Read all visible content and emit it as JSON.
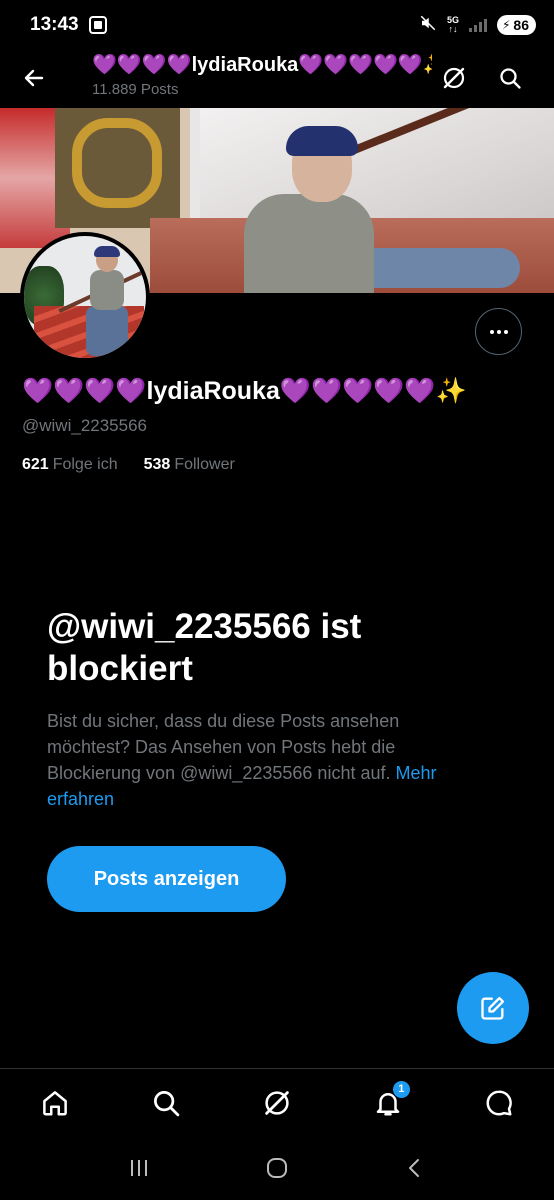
{
  "status_bar": {
    "time": "13:43",
    "network": "5G",
    "battery": "86"
  },
  "header": {
    "title": "💜💜💜💜lydiaRouka💜💜💜💜💜✨",
    "posts_count": "11.889 Posts"
  },
  "profile": {
    "display_name": "💜💜💜💜lydiaRouka💜💜💜💜💜✨",
    "handle": "@wiwi_2235566",
    "following_count": "621",
    "following_label": "Folge ich",
    "followers_count": "538",
    "followers_label": "Follower"
  },
  "blocked": {
    "title": "@wiwi_2235566 ist blockiert",
    "description": "Bist du sicher, dass du diese Posts ansehen möchtest? Das Ansehen von Posts hebt die Blockierung von @wiwi_2235566 nicht auf.",
    "link": "Mehr erfahren",
    "button_label": "Posts anzeigen"
  },
  "bottom_nav": {
    "notifications_badge": "1"
  },
  "colors": {
    "accent": "#1d9bf0",
    "background": "#000000",
    "secondary_text": "#71767b"
  },
  "icons": {
    "back": "arrow-left-icon",
    "grok": "grok-icon",
    "search": "search-icon",
    "more": "more-horizontal-icon",
    "compose": "compose-icon",
    "home": "home-icon",
    "notifications": "bell-icon",
    "messages": "message-icon"
  }
}
